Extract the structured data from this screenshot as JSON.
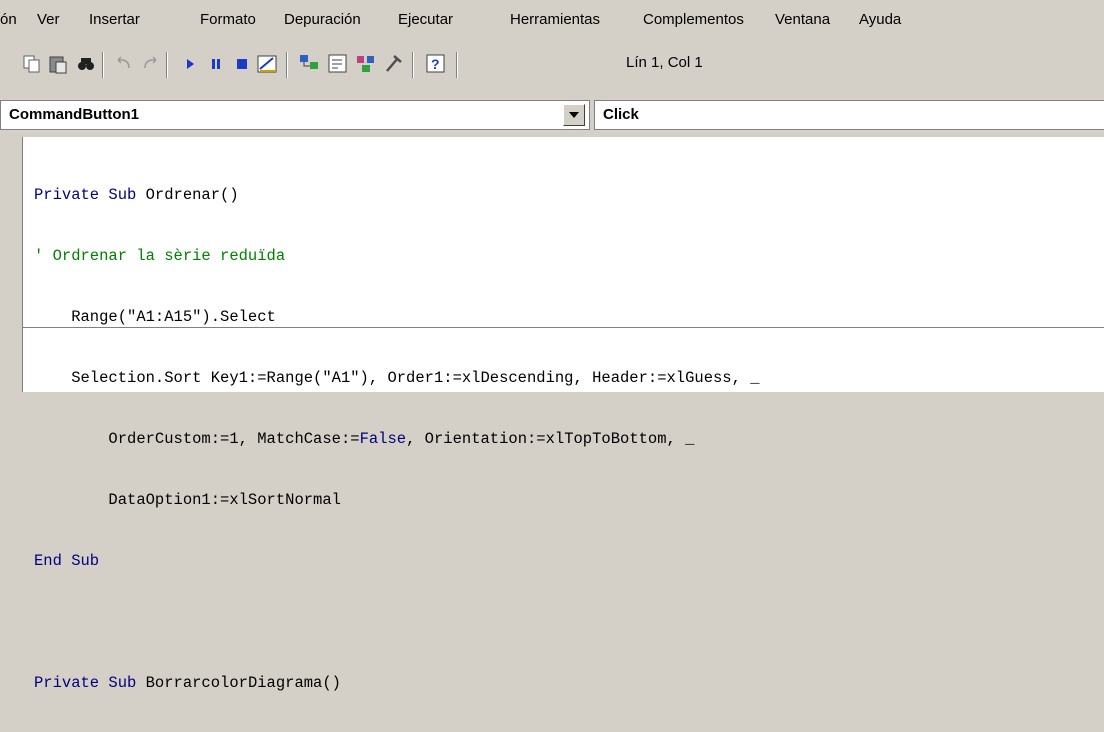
{
  "menu": [
    "ón",
    "Ver",
    "Insertar",
    "Formato",
    "Depuración",
    "Ejecutar",
    "Herramientas",
    "Complementos",
    "Ventana",
    "Ayuda"
  ],
  "toolbar": {
    "icons": [
      "copy-icon",
      "paste-icon",
      "find-icon",
      "undo-icon",
      "redo-icon",
      "run-icon",
      "break-icon",
      "reset-icon",
      "design-mode-icon",
      "project-explorer-icon",
      "properties-icon",
      "object-browser-icon",
      "toolbox-icon",
      "help-icon"
    ],
    "position": "Lín 1, Col 1"
  },
  "object_combo": "CommandButton1",
  "procedure_combo": "Click",
  "code": {
    "l1a": "Private Sub ",
    "l1b": "Ordrenar()",
    "l2": "' Ordrenar la sèrie reduïda",
    "l3": "    Range(\"A1:A15\").Select",
    "l4": "    Selection.Sort Key1:=Range(\"A1\"), Order1:=xlDescending, Header:=xlGuess, _",
    "l5a": "        OrderCustom:=1, MatchCase:=",
    "l5b": "False",
    "l5c": ", Orientation:=xlTopToBottom, _",
    "l6": "        DataOption1:=xlSortNormal",
    "l7": "End Sub",
    "l9a": "Private Sub ",
    "l9b": "BorrarcolorDiagrama()"
  },
  "colors": {
    "keyword": "#00007f",
    "comment": "#007f00",
    "chrome": "#d4d0c8"
  }
}
